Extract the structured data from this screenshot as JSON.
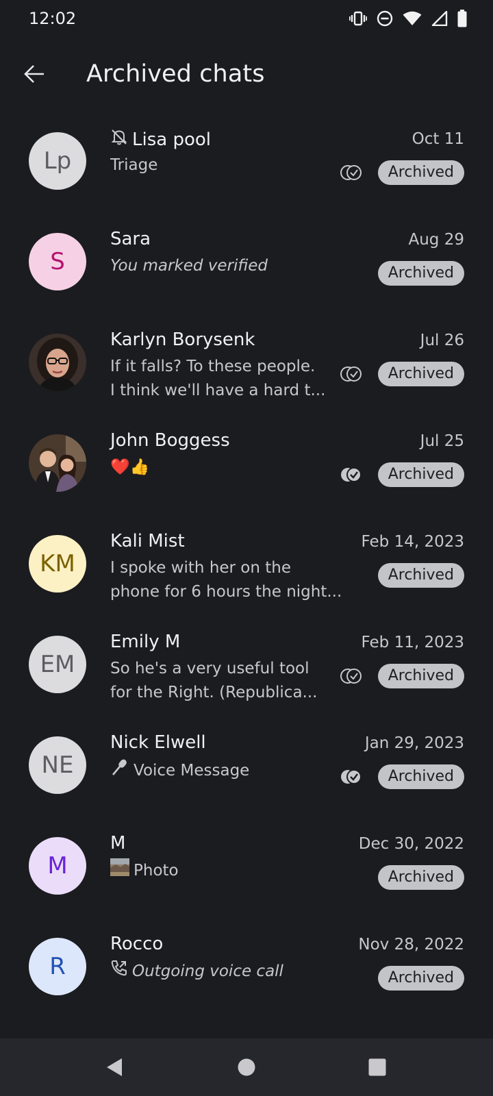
{
  "status_bar": {
    "time": "12:02",
    "icons": [
      "vibrate-icon",
      "do-not-disturb-icon",
      "wifi-icon",
      "cell-signal-icon",
      "battery-icon"
    ]
  },
  "app_bar": {
    "title": "Archived chats",
    "back_icon": "arrow-back-icon"
  },
  "chats": [
    {
      "name": "Lisa pool",
      "muted": true,
      "preview": [
        "Triage"
      ],
      "italic": false,
      "date": "Oct 11",
      "badge": "Archived",
      "receipt": "outline",
      "avatar": {
        "initials": "Lp",
        "bg": "#dcdcdf",
        "fg": "#5d5d61"
      }
    },
    {
      "name": "Sara",
      "muted": false,
      "preview": [
        "You marked verified"
      ],
      "italic": true,
      "date": "Aug 29",
      "badge": "Archived",
      "receipt": "none",
      "avatar": {
        "initials": "S",
        "bg": "#f6d1e6",
        "fg": "#b5136f"
      }
    },
    {
      "name": "Karlyn Borysenk",
      "muted": false,
      "preview": [
        "If it falls? To these people.",
        "I think we'll have a hard t..."
      ],
      "italic": false,
      "date": "Jul 26",
      "badge": "Archived",
      "receipt": "outline",
      "avatar": {
        "photo": "woman-with-glasses"
      }
    },
    {
      "name": "John Boggess",
      "muted": false,
      "preview": [
        "❤️👍"
      ],
      "italic": false,
      "date": "Jul 25",
      "badge": "Archived",
      "receipt": "filled",
      "avatar": {
        "photo": "couple"
      }
    },
    {
      "name": "Kali Mist",
      "muted": false,
      "preview": [
        "I spoke with her on the",
        "phone for 6 hours the night..."
      ],
      "italic": false,
      "date": "Feb 14, 2023",
      "badge": "Archived",
      "receipt": "none",
      "avatar": {
        "initials": "KM",
        "bg": "#fcf1c4",
        "fg": "#7b6100"
      }
    },
    {
      "name": "Emily M",
      "muted": false,
      "preview": [
        "So he's a very useful tool",
        "for the Right.  (Republica..."
      ],
      "italic": false,
      "date": "Feb 11, 2023",
      "badge": "Archived",
      "receipt": "outline",
      "avatar": {
        "initials": "EM",
        "bg": "#dcdcdf",
        "fg": "#5d5d61"
      }
    },
    {
      "name": "Nick Elwell",
      "muted": false,
      "preview": [
        "Voice Message"
      ],
      "preview_icon": "microphone-icon",
      "italic": false,
      "date": "Jan 29, 2023",
      "badge": "Archived",
      "receipt": "filled",
      "avatar": {
        "initials": "NE",
        "bg": "#dcdcdf",
        "fg": "#5d5d61"
      }
    },
    {
      "name": "M",
      "muted": false,
      "preview": [
        "Photo"
      ],
      "preview_icon": "photo-thumbnail-icon",
      "italic": false,
      "date": "Dec 30, 2022",
      "badge": "Archived",
      "receipt": "none",
      "avatar": {
        "initials": "M",
        "bg": "#ebdcfa",
        "fg": "#6b24d6"
      }
    },
    {
      "name": "Rocco",
      "muted": false,
      "preview": [
        "Outgoing voice call"
      ],
      "preview_icon": "outgoing-call-icon",
      "italic": true,
      "date": "Nov 28, 2022",
      "badge": "Archived",
      "receipt": "none",
      "avatar": {
        "initials": "R",
        "bg": "#dde7fb",
        "fg": "#2353b5"
      }
    }
  ],
  "nav_bar": {
    "buttons": [
      "back-triangle-icon",
      "home-circle-icon",
      "recents-square-icon"
    ]
  }
}
